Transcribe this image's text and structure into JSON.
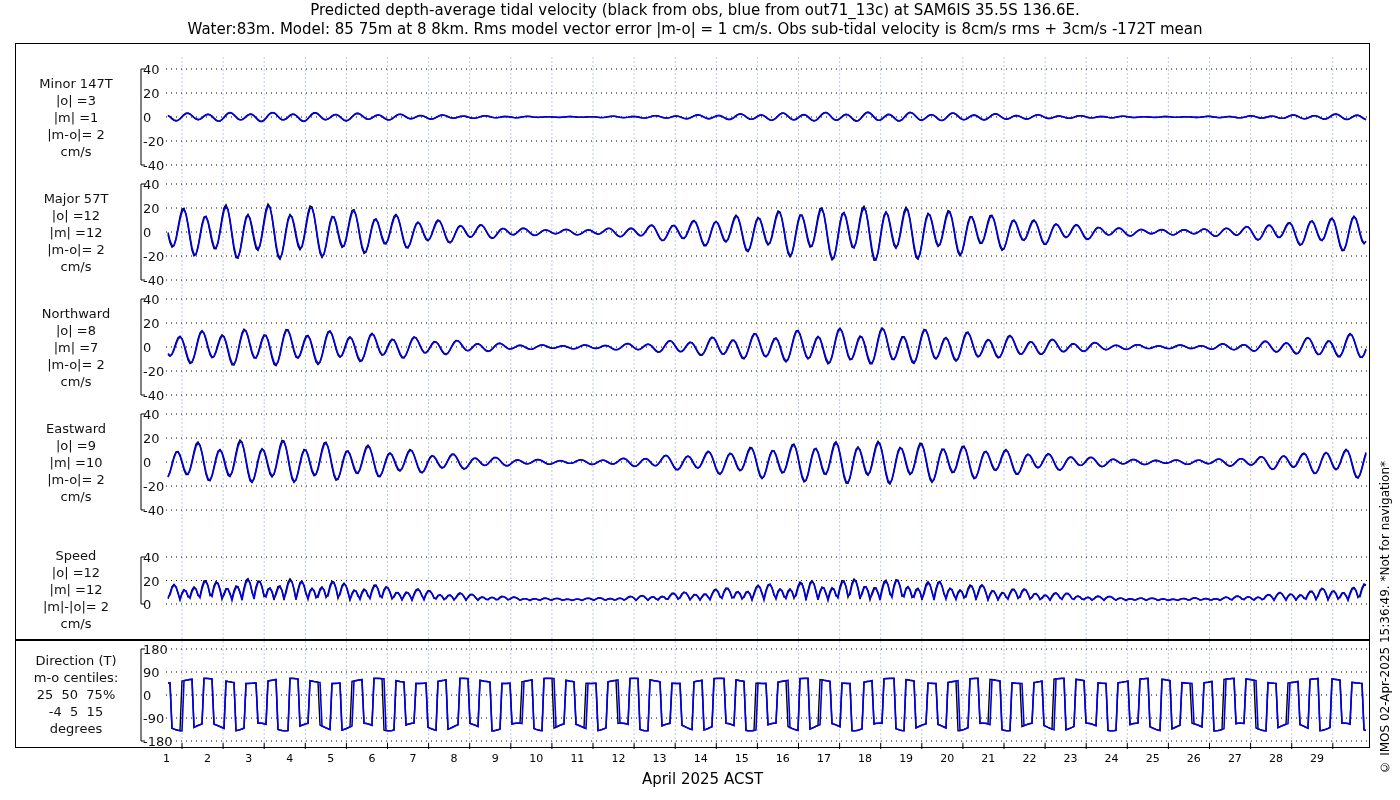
{
  "title_lines": [
    "Predicted depth-average tidal velocity (black from obs, blue from out71_13c) at SAM6IS 35.5S 136.6E.",
    "Water:83m. Model: 85 75m at 8 8km. Rms model vector error |m-o| = 1 cm/s. Obs sub-tidal velocity is 8cm/s rms + 3cm/s -172T mean"
  ],
  "panels": [
    {
      "kind": "velocity",
      "label_lines": [
        "Minor 147T",
        "|o| =3",
        "|m| =1",
        "|m-o|= 2",
        "cm/s"
      ],
      "yticks": [
        "40",
        "20",
        "0",
        "-20",
        "-40"
      ]
    },
    {
      "kind": "velocity",
      "label_lines": [
        "Major 57T",
        "|o| =12",
        "|m| =12",
        "|m-o|= 2",
        "cm/s"
      ],
      "yticks": [
        "40",
        "20",
        "0",
        "-20",
        "-40"
      ]
    },
    {
      "kind": "velocity",
      "label_lines": [
        "Northward",
        "|o| =8",
        "|m| =7",
        "|m-o|= 2",
        "cm/s"
      ],
      "yticks": [
        "40",
        "20",
        "0",
        "-20",
        "-40"
      ]
    },
    {
      "kind": "velocity",
      "label_lines": [
        "Eastward",
        "|o| =9",
        "|m| =10",
        "|m-o|= 2",
        "cm/s"
      ],
      "yticks": [
        "40",
        "20",
        "0",
        "-20",
        "-40"
      ]
    },
    {
      "kind": "speed",
      "label_lines": [
        "Speed",
        "|o| =12",
        "|m| =12",
        "|m|-|o|= 2",
        "cm/s"
      ],
      "yticks": [
        "40",
        "20",
        "0"
      ]
    },
    {
      "kind": "direction",
      "label_lines": [
        "Direction (T)",
        "m-o centiles:",
        "25  50  75%",
        "-4  5  15",
        "degrees"
      ],
      "yticks": [
        "180",
        "90",
        "0",
        "-90",
        "-180"
      ]
    }
  ],
  "x_axis": {
    "ticks": [
      "1",
      "2",
      "3",
      "4",
      "5",
      "6",
      "7",
      "8",
      "9",
      "10",
      "11",
      "12",
      "13",
      "14",
      "15",
      "16",
      "17",
      "18",
      "19",
      "20",
      "21",
      "22",
      "23",
      "24",
      "25",
      "26",
      "27",
      "28",
      "29"
    ],
    "label": "April 2025 ACST"
  },
  "footer": "© IMOS 02-Apr-2025 15:36:49. *Not for navigation*"
}
